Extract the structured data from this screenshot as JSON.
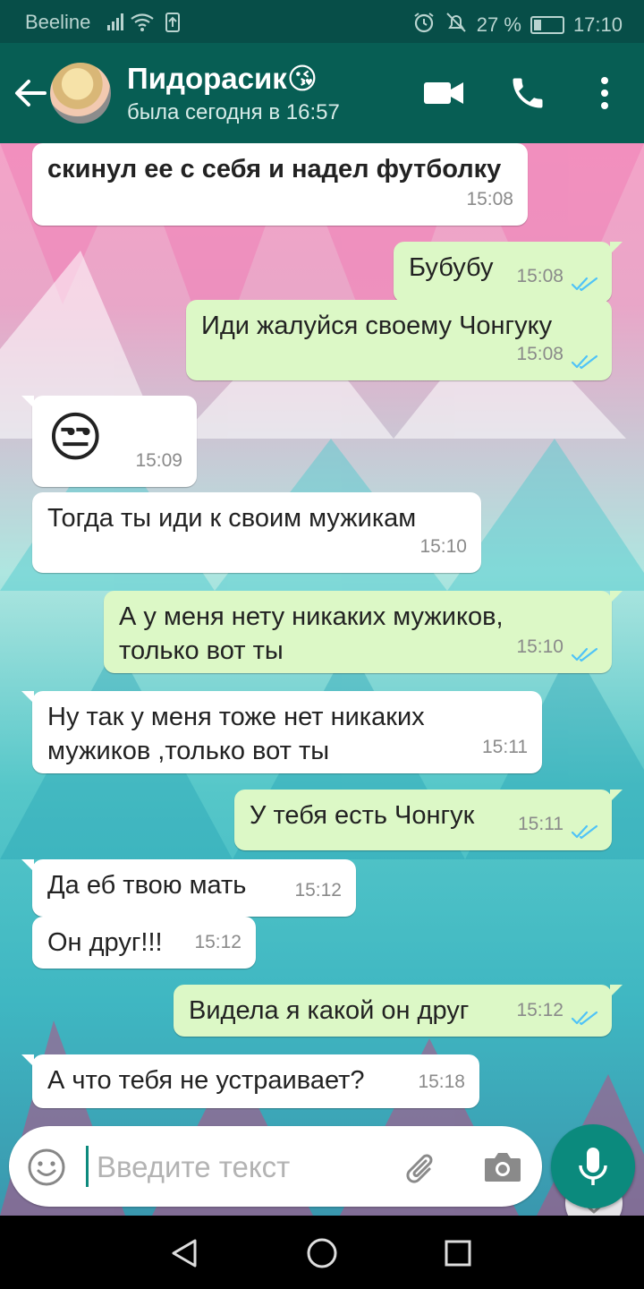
{
  "status_bar": {
    "carrier": "Beeline",
    "battery": "27 %",
    "battery_level": 0.27,
    "time": "17:10"
  },
  "header": {
    "contact_name": "Пидорасик",
    "contact_emoji": "😘",
    "last_seen": "была сегодня в 16:57"
  },
  "messages": [
    {
      "direction": "in",
      "text": "скинул ее с себя и надел футболку",
      "time": "15:08",
      "bold": true
    },
    {
      "direction": "out",
      "text": "Бубубу",
      "time": "15:08",
      "read": true
    },
    {
      "direction": "out",
      "text": "Иди жалуйся своему Чонгуку",
      "time": "15:08",
      "read": true
    },
    {
      "direction": "in",
      "text": "😒",
      "time": "15:09"
    },
    {
      "direction": "in",
      "text": "Тогда ты иди к своим мужикам",
      "time": "15:10"
    },
    {
      "direction": "out",
      "text": "А у меня нету никаких мужиков,\nтолько вот ты",
      "time": "15:10",
      "read": true
    },
    {
      "direction": "in",
      "text": "Ну так у меня тоже нет никаких\nмужиков ,только вот ты",
      "time": "15:11"
    },
    {
      "direction": "out",
      "text": "У тебя есть Чонгук",
      "time": "15:11",
      "read": true
    },
    {
      "direction": "in",
      "text": "Да еб твою мать",
      "time": "15:12"
    },
    {
      "direction": "in",
      "text": "Он друг!!!",
      "time": "15:12"
    },
    {
      "direction": "out",
      "text": "Видела я какой он друг",
      "time": "15:12",
      "read": true
    },
    {
      "direction": "in",
      "text": "А что тебя не устраивает?",
      "time": "15:18"
    }
  ],
  "composer": {
    "placeholder": "Введите текст"
  },
  "colors": {
    "header": "#075e54",
    "status_bar": "#074e48",
    "outgoing": "#dcf8c6",
    "incoming": "#ffffff",
    "accent": "#0b8a7d",
    "read_ticks": "#4fc3f7"
  },
  "icons": {
    "back": "arrow-left-icon",
    "video": "video-camera-icon",
    "call": "phone-icon",
    "menu": "more-vertical-icon",
    "emoji": "smiley-icon",
    "attach": "paperclip-icon",
    "camera": "camera-icon",
    "mic": "microphone-icon",
    "scroll": "double-chevron-down-icon"
  }
}
